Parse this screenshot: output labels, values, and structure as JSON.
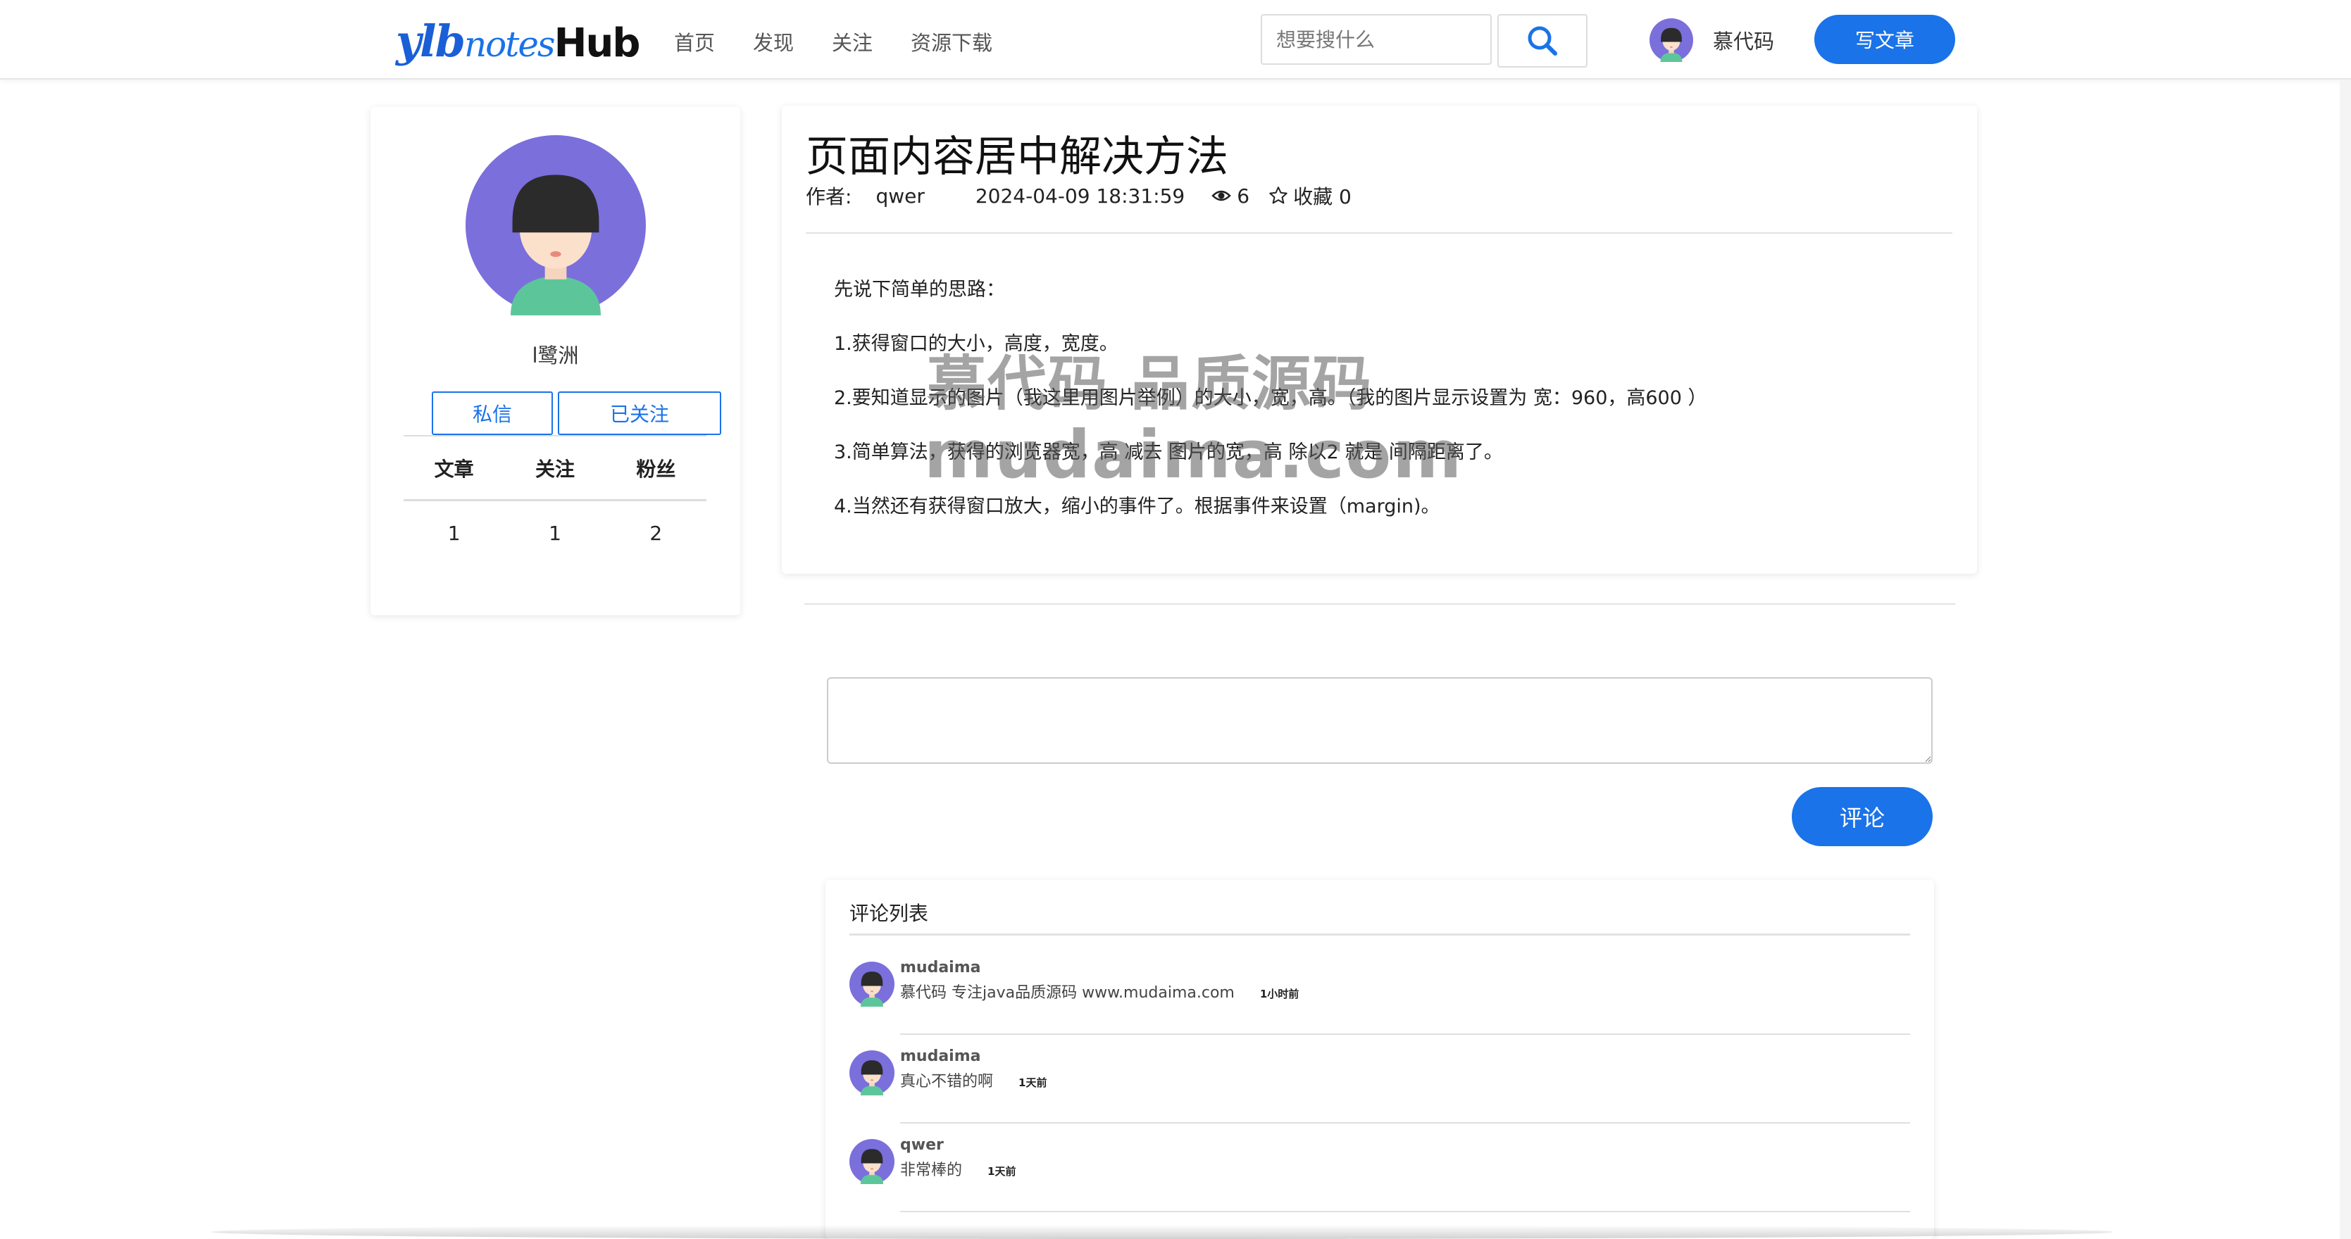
{
  "header": {
    "logo": {
      "part1": "ylb",
      "part2": "notes",
      "part3": "Hub"
    },
    "nav": [
      "首页",
      "发现",
      "关注",
      "资源下载"
    ],
    "search_placeholder": "想要搜什么",
    "username": "慕代码",
    "write_button": "写文章"
  },
  "profile": {
    "name": "l鹭洲",
    "message_button": "私信",
    "follow_button": "已关注",
    "stats_labels": [
      "文章",
      "关注",
      "粉丝"
    ],
    "stats_values": [
      "1",
      "1",
      "2"
    ]
  },
  "article": {
    "title": "页面内容居中解决方法",
    "author_label": "作者:",
    "author": "qwer",
    "date": "2024-04-09 18:31:59",
    "views": "6",
    "favorites_label": "收藏 0",
    "paragraphs": [
      "先说下简单的思路：",
      "1.获得窗口的大小，高度，宽度。",
      "2.要知道显示的图片（我这里用图片举例）的大小，宽，高。（我的图片显示设置为 宽：960，高600 ）",
      "3.简单算法，获得的浏览器宽，高 减去 图片的宽，高 除以2 就是 间隔距离了。",
      "4.当然还有获得窗口放大，缩小的事件了。根据事件来设置（margin)。"
    ]
  },
  "comment_form": {
    "submit_button": "评论"
  },
  "comments": {
    "title": "评论列表",
    "items": [
      {
        "user": "mudaima",
        "text": "慕代码 专注java品质源码 www.mudaima.com",
        "time": "1小时前"
      },
      {
        "user": "mudaima",
        "text": "真心不错的啊",
        "time": "1天前"
      },
      {
        "user": "qwer",
        "text": "非常棒的",
        "time": "1天前"
      }
    ]
  },
  "watermark": {
    "line1": "慕代码 品质源码",
    "line2": "mudaima.com"
  },
  "colors": {
    "accent": "#1a73e8",
    "avatar_bg": "#7b6fdc"
  }
}
